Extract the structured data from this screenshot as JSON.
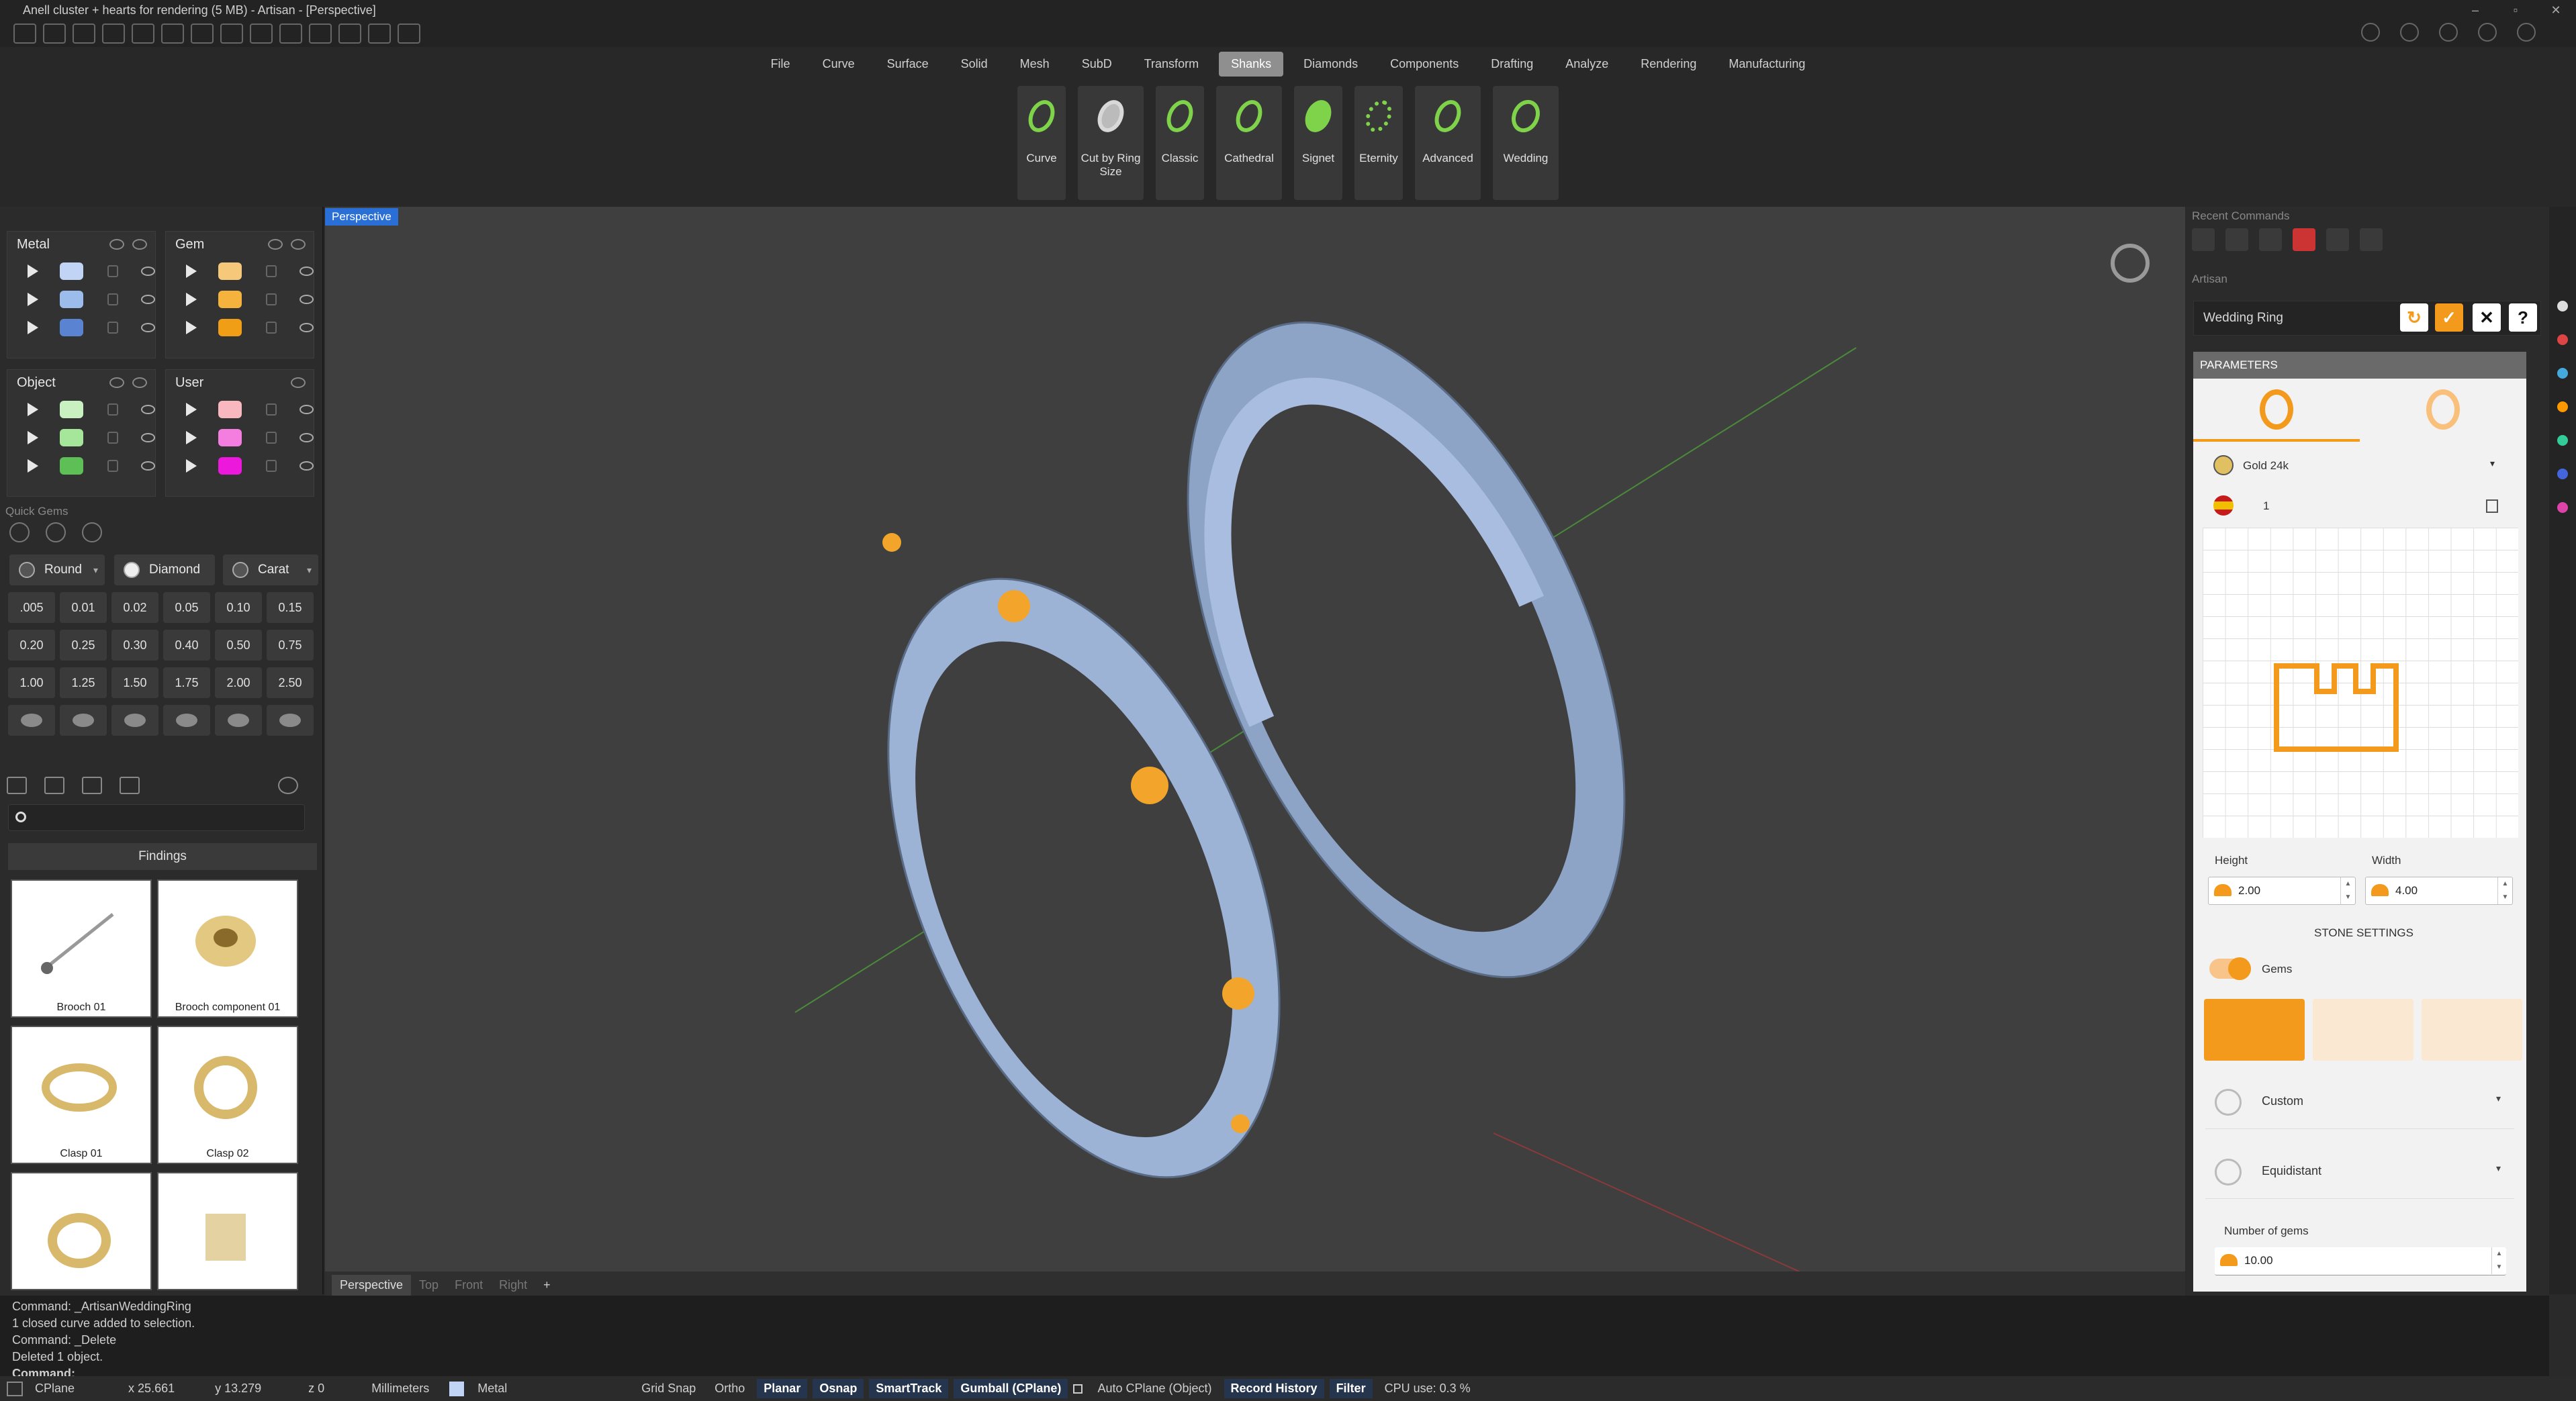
{
  "title": "Anell cluster + hearts for rendering (5 MB) - Artisan - [Perspective]",
  "menu": [
    "File",
    "Curve",
    "Surface",
    "Solid",
    "Mesh",
    "SubD",
    "Transform",
    "Shanks",
    "Diamonds",
    "Components",
    "Drafting",
    "Analyze",
    "Rendering",
    "Manufacturing"
  ],
  "active_menu": "Shanks",
  "shanks": [
    "Curve",
    "Cut by Ring Size",
    "Classic",
    "Cathedral",
    "Signet",
    "Eternity",
    "Advanced",
    "Wedding"
  ],
  "layers": {
    "metal": {
      "name": "Metal",
      "colors": [
        "#c2d4f5",
        "#9cbcec",
        "#5a84d2"
      ]
    },
    "gem": {
      "name": "Gem",
      "colors": [
        "#f6c97a",
        "#f5b23c",
        "#f09e16"
      ]
    },
    "object": {
      "name": "Object",
      "colors": [
        "#c9f0c0",
        "#a6e69a",
        "#5dbf56"
      ]
    },
    "user": {
      "name": "User",
      "colors": [
        "#f9b7c0",
        "#f47ee0",
        "#ec19dc"
      ]
    }
  },
  "quick_gems": {
    "title": "Quick Gems",
    "shape": "Round",
    "material": "Diamond",
    "unit": "Carat",
    "carats": [
      ".005",
      "0.01",
      "0.02",
      "0.05",
      "0.10",
      "0.15",
      "0.20",
      "0.25",
      "0.30",
      "0.40",
      "0.50",
      "0.75",
      "1.00",
      "1.25",
      "1.50",
      "1.75",
      "2.00",
      "2.50"
    ]
  },
  "findings": {
    "header": "Findings",
    "items": [
      "Brooch 01",
      "Brooch component 01",
      "Clasp 01",
      "Clasp 02",
      "",
      ""
    ]
  },
  "viewport": {
    "tab": "Perspective",
    "bottom_tabs": [
      "Perspective",
      "Top",
      "Front",
      "Right",
      "+"
    ]
  },
  "right": {
    "recent_title": "Recent Commands",
    "artisan_title": "Artisan",
    "command": "Wedding Ring",
    "params_title": "PARAMETERS",
    "material": "Gold 24k",
    "size": "1",
    "height_label": "Height",
    "height": "2.00",
    "width_label": "Width",
    "width": "4.00",
    "stone_settings": "STONE SETTINGS",
    "gems_label": "Gems",
    "custom": "Custom",
    "equidistant": "Equidistant",
    "num_gems_label": "Number of gems",
    "num_gems": "10.00"
  },
  "command_history": [
    "Command: _ArtisanWeddingRing",
    "1 closed curve added to selection.",
    "Command: _Delete",
    "Deleted 1 object."
  ],
  "command_prompt": "Command:",
  "status": {
    "cplane": "CPlane",
    "x": "x 25.661",
    "y": "y 13.279",
    "z": "z 0",
    "units": "Millimeters",
    "layer": "Metal",
    "toggles": [
      "Grid Snap",
      "Ortho",
      "Planar",
      "Osnap",
      "SmartTrack",
      "Gumball (CPlane)"
    ],
    "auto_cplane": "Auto CPlane (Object)",
    "record": "Record History",
    "filter": "Filter",
    "cpu": "CPU use: 0.3 %"
  }
}
